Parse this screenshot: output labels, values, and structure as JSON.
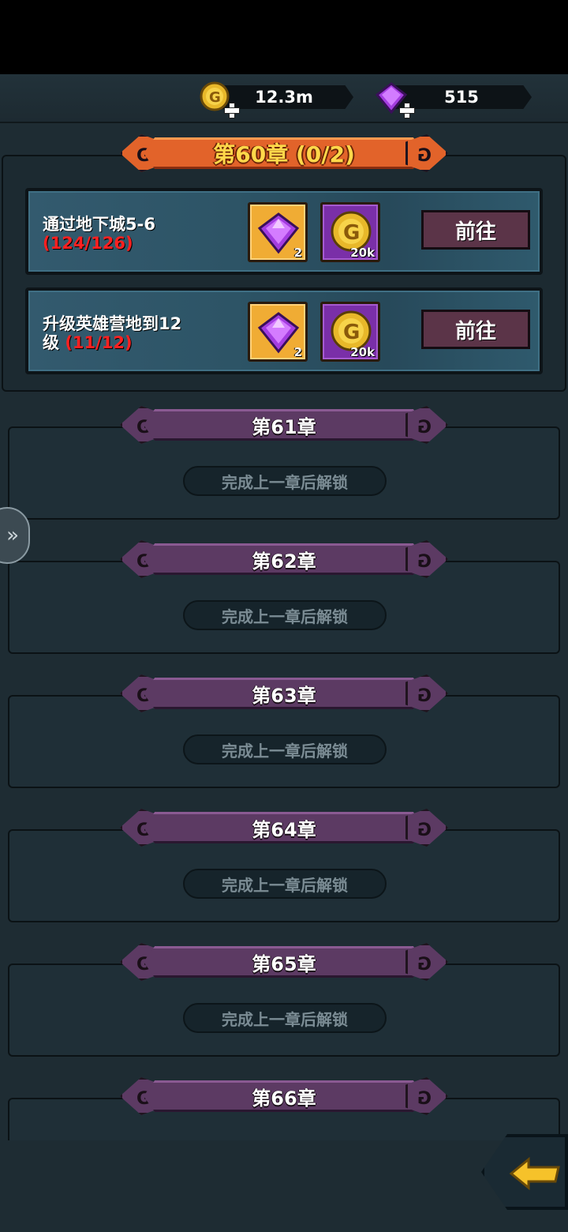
{
  "currencies": {
    "gold": "12.3m",
    "gem": "515"
  },
  "chapter_60": {
    "title": "第60章 (0/2)",
    "tasks": [
      {
        "title": "通过地下城5-6",
        "progress": "(124/126)",
        "rewards": [
          {
            "icon": "gem-icon",
            "qty": "2"
          },
          {
            "icon": "gold-coin-icon",
            "qty": "20k"
          }
        ],
        "button": "前往"
      },
      {
        "title": "升级英雄营地到12级",
        "title_prefix": "升级英雄营地到12",
        "title_suffix": "级",
        "progress": "(11/12)",
        "rewards": [
          {
            "icon": "gem-icon",
            "qty": "2"
          },
          {
            "icon": "gold-coin-icon",
            "qty": "20k"
          }
        ],
        "button": "前往"
      }
    ]
  },
  "locked_chapters": [
    {
      "title": "第61章",
      "status": "完成上一章后解锁"
    },
    {
      "title": "第62章",
      "status": "完成上一章后解锁"
    },
    {
      "title": "第63章",
      "status": "完成上一章后解锁"
    },
    {
      "title": "第64章",
      "status": "完成上一章后解锁"
    },
    {
      "title": "第65章",
      "status": "完成上一章后解锁"
    },
    {
      "title": "第66章"
    }
  ],
  "colors": {
    "background": "#1e2c33",
    "ribbon_active": "#e2632a",
    "ribbon_locked": "#5c3a63",
    "progress_red": "#ff2020",
    "button": "#5b3448"
  }
}
